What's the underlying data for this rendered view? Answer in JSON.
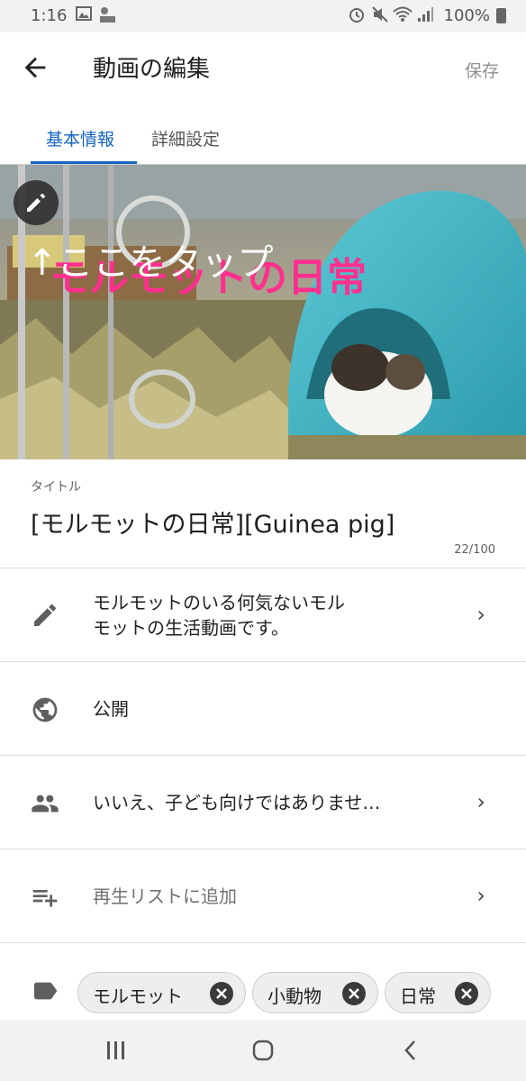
{
  "status_bar": {
    "time": "1:16",
    "battery": "100%",
    "icons": [
      "image-icon",
      "weather-icon",
      "alarm-icon",
      "mute-icon",
      "wifi-icon",
      "signal-icon",
      "battery-icon"
    ]
  },
  "app_bar": {
    "title": "動画の編集",
    "save_label": "保存"
  },
  "tabs": [
    {
      "label": "基本情報",
      "active": true
    },
    {
      "label": "詳細設定",
      "active": false
    }
  ],
  "thumbnail": {
    "overlay_text_1": "↑ここをタップ",
    "overlay_text_2": "モルモットの日常"
  },
  "title_field": {
    "label": "タイトル",
    "value": "[モルモットの日常][Guinea pig]",
    "counter": "22/100"
  },
  "rows": {
    "description": {
      "line1": "モルモットのいる何気ないモル",
      "line2": "モットの生活動画です。"
    },
    "visibility": {
      "label": "公開"
    },
    "audience": {
      "label": "いいえ、子ども向けではありませ…"
    },
    "playlist": {
      "label": "再生リストに追加"
    }
  },
  "tags": [
    "モルモット",
    "小動物",
    "日常"
  ],
  "colors": {
    "accent": "#1565c0",
    "overlay_pink": "#ff2f8e",
    "dome_teal": "#41b6c4"
  }
}
